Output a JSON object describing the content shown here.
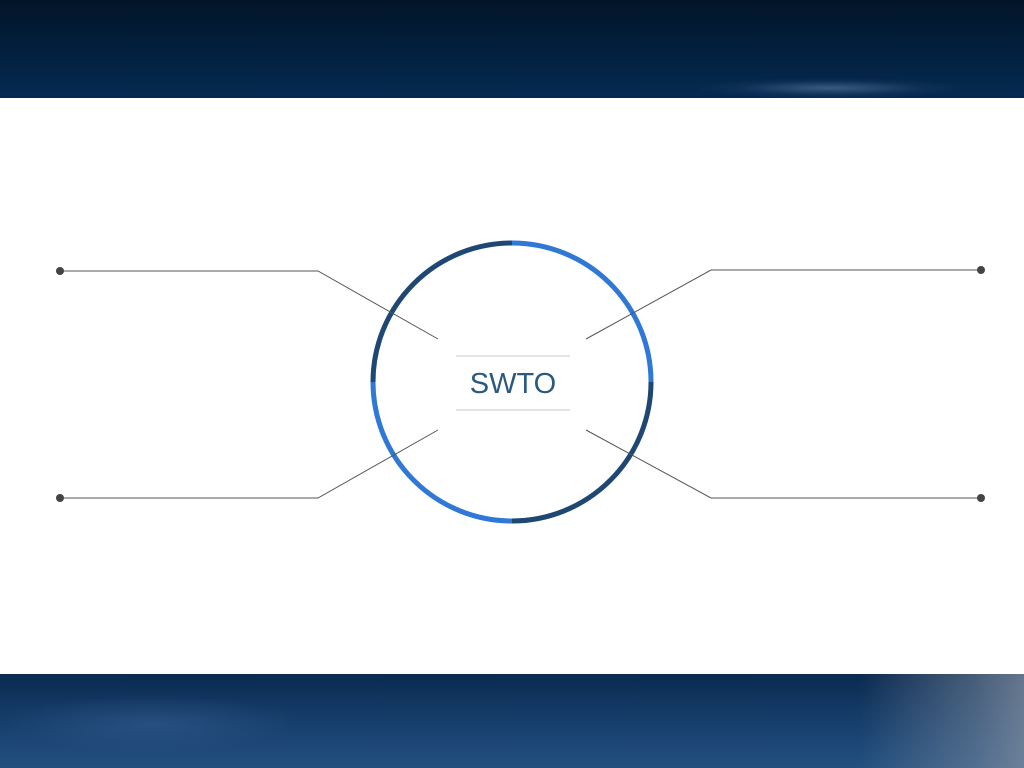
{
  "slide": {
    "center_text": "SWTO"
  },
  "colors": {
    "ring_light": "#2f78d6",
    "ring_dark": "#1e4873",
    "connector_line": "#4a4a4a",
    "endpoint_dot": "#444444",
    "center_text": "#2b5a80",
    "band_dark": "#031d3a"
  }
}
